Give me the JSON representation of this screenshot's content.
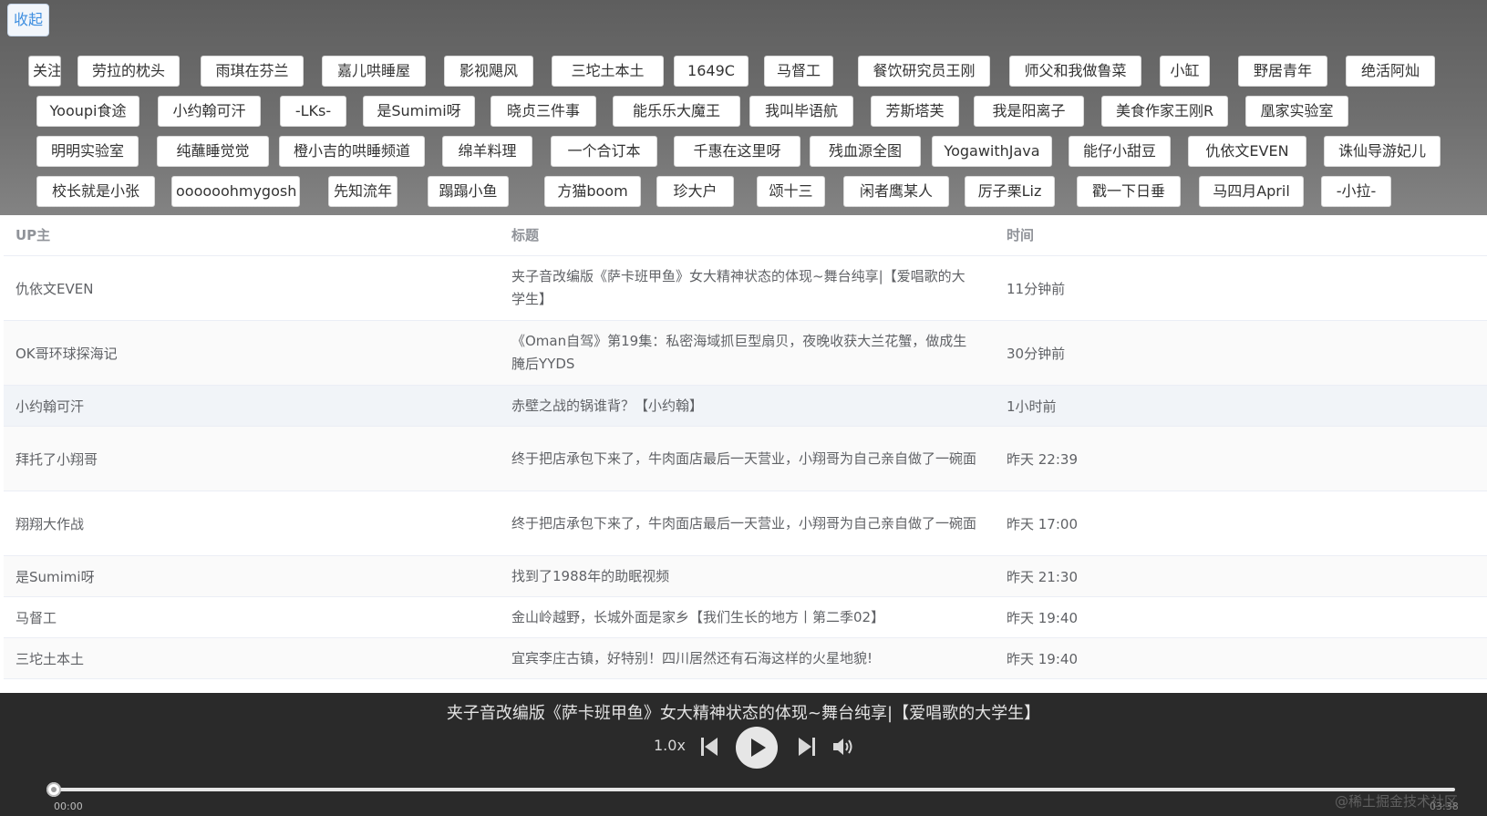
{
  "collapse_label": "收起",
  "tags": [
    "关注",
    "劳拉的枕头",
    "雨琪在芬兰",
    "嘉儿哄睡屋",
    "影视飓风",
    "三坨土本土",
    "1649C",
    "马督工",
    "餐饮研究员王刚",
    "师父和我做鲁菜",
    "小缸",
    "野居青年",
    "绝活阿灿",
    "Yooupi食途",
    "小约翰可汗",
    "-LKs-",
    "是Sumimi呀",
    "晓贞三件事",
    "能乐乐大魔王",
    "我叫毕语航",
    "芳斯塔芙",
    "我是阳离子",
    "美食作家王刚R",
    "凰家实验室",
    "明明实验室",
    "纯蘸睡觉觉",
    "橙小吉的哄睡频道",
    "绵羊料理",
    "一个合订本",
    "千惠在这里呀",
    "残血源全图",
    "YogawithJava",
    "能仔小甜豆",
    "仇依文EVEN",
    "诛仙导游妃儿",
    "校长就是小张",
    "oooooohmygosh",
    "先知流年",
    "蹋蹋小鱼",
    "方猫boom",
    "珍大户",
    "颂十三",
    "闲者鹰某人",
    "厉子栗Liz",
    "戳一下日垂",
    "马四月April",
    "-小拉-"
  ],
  "table": {
    "headers": {
      "up": "UP主",
      "title": "标题",
      "time": "时间"
    },
    "rows": [
      {
        "up": "仇依文EVEN",
        "title": "夹子音改编版《萨卡班甲鱼》女大精神状态的体现~舞台纯享|【爱唱歌的大学生】",
        "time": "11分钟前"
      },
      {
        "up": "OK哥环球探海记",
        "title": "《Oman自驾》第19集：私密海域抓巨型扇贝，夜晚收获大兰花蟹，做成生腌后YYDS",
        "time": "30分钟前"
      },
      {
        "up": "小约翰可汗",
        "title": "赤壁之战的锅谁背？【小约翰】",
        "time": "1小时前"
      },
      {
        "up": "拜托了小翔哥",
        "title": "终于把店承包下来了，牛肉面店最后一天营业，小翔哥为自己亲自做了一碗面",
        "time": "昨天 22:39"
      },
      {
        "up": "翔翔大作战",
        "title": "终于把店承包下来了，牛肉面店最后一天营业，小翔哥为自己亲自做了一碗面",
        "time": "昨天 17:00"
      },
      {
        "up": "是Sumimi呀",
        "title": "找到了1988年的助眠视频",
        "time": "昨天 21:30"
      },
      {
        "up": "马督工",
        "title": "金山岭越野，长城外面是家乡【我们生长的地方丨第二季02】",
        "time": "昨天 19:40"
      },
      {
        "up": "三坨土本土",
        "title": "宜宾李庄古镇，好特别！四川居然还有石海这样的火星地貌!",
        "time": "昨天 19:40"
      }
    ]
  },
  "player": {
    "now_playing": "夹子音改编版《萨卡班甲鱼》女大精神状态的体现~舞台纯享|【爱唱歌的大学生】",
    "speed": "1.0x",
    "current_time": "00:00",
    "total_time": "03:38",
    "progress": 0.0
  },
  "watermark": "@稀土掘金技术社区",
  "icons": [
    "previous-icon",
    "play-icon",
    "next-icon",
    "volume-icon"
  ]
}
